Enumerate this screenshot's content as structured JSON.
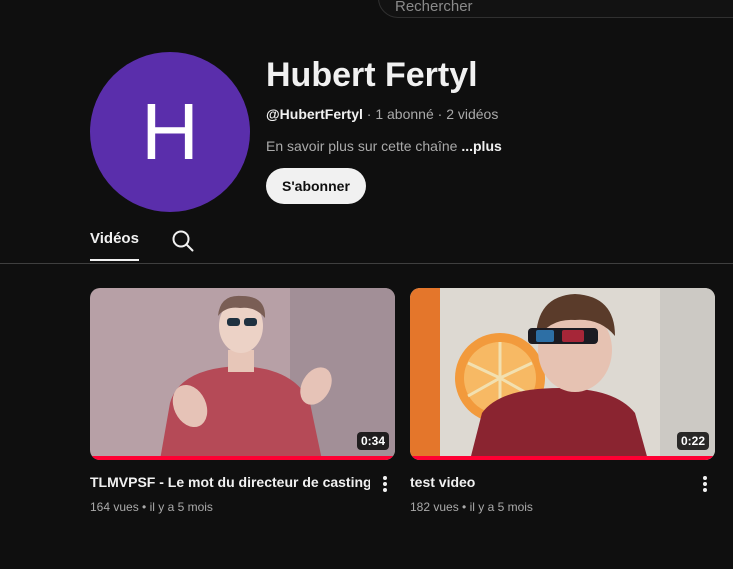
{
  "search": {
    "placeholder": "Rechercher"
  },
  "channel": {
    "avatar_letter": "H",
    "avatar_color": "#5a2eab",
    "name": "Hubert Fertyl",
    "handle": "@HubertFertyl",
    "subscribers": "1 abonné",
    "video_count": "2 vidéos",
    "separator": " · ",
    "about_text": "En savoir plus sur cette chaîne ",
    "about_more": "...plus",
    "subscribe_label": "S'abonner"
  },
  "tabs": {
    "videos_label": "Vidéos",
    "search_icon": "search-icon"
  },
  "videos": [
    {
      "title": "TLMVPSF - Le mot du directeur de casting !",
      "duration": "0:34",
      "views": "164 vues",
      "age": "il y a 5 mois",
      "watched_fraction": 1.0
    },
    {
      "title": "test video",
      "duration": "0:22",
      "views": "182 vues",
      "age": "il y a 5 mois",
      "watched_fraction": 1.0
    }
  ],
  "stats_separator": " • ",
  "colors": {
    "background": "#0f0f0f",
    "progress": "#ff0033",
    "accent_text": "#f1f1f1"
  }
}
